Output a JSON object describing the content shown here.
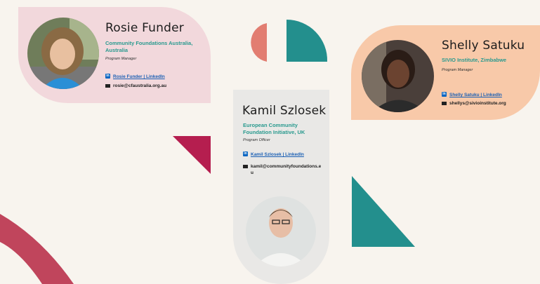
{
  "colors": {
    "background": "#f8f4ee",
    "pink_card": "#f2d8dc",
    "peach_card": "#f8c9a9",
    "grey_card": "#e9e8e6",
    "teal": "#238f8d",
    "crimson": "#b51e4f",
    "coral": "#e27d71",
    "deep_red": "#c0455c",
    "org_text": "#2a9a8f"
  },
  "cards": {
    "rosie": {
      "name": "Rosie Funder",
      "org": "Community Foundations Australia, Australia",
      "role": "Program Manager",
      "linkedin": "Rosie Funder | LinkedIn",
      "email": "rosie@cfaustralia.org.au"
    },
    "kamil": {
      "name": "Kamil Szlosek",
      "org": "European Community Foundation Initiative, UK",
      "role": "Program Officer",
      "linkedin": "Kamil Szlosek | LinkedIn",
      "email": "kamil@communityfoundations.eu"
    },
    "shelly": {
      "name": "Shelly Satuku",
      "org": "SIVIO Institute, Zimbabwe",
      "role": "Program Manager",
      "linkedin": "Shelly Satuku | LinkedIn",
      "email": "shellys@sivioinstitute.org"
    }
  },
  "icons": {
    "linkedin": "linkedin-icon",
    "email": "envelope-icon"
  }
}
